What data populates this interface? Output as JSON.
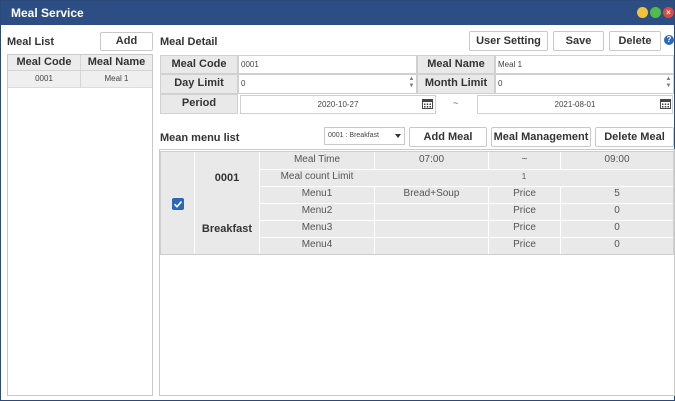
{
  "window": {
    "title": "Meal Service"
  },
  "left": {
    "title": "Meal List",
    "add_label": "Add",
    "columns": [
      "Meal Code",
      "Meal Name"
    ],
    "rows": [
      {
        "code": "0001",
        "name": "Meal 1"
      }
    ]
  },
  "detail": {
    "title": "Meal Detail",
    "user_setting_label": "User Setting",
    "save_label": "Save",
    "delete_label": "Delete",
    "meal_code_label": "Meal Code",
    "meal_code_value": "0001",
    "meal_name_label": "Meal Name",
    "meal_name_value": "Meal 1",
    "day_limit_label": "Day Limit",
    "day_limit_value": "0",
    "month_limit_label": "Month Limit",
    "month_limit_value": "0",
    "period_label": "Period",
    "period_start": "2020-10-27",
    "period_sep": "~",
    "period_end": "2021-08-01"
  },
  "menu": {
    "title": "Mean menu list",
    "select_value": "0001 : Breakfast",
    "add_meal_label": "Add Meal",
    "meal_management_label": "Meal Management",
    "delete_meal_label": "Delete Meal",
    "code": "0001",
    "name": "Breakfast",
    "checked": true,
    "meal_time_label": "Meal Time",
    "meal_time_start": "07:00",
    "meal_time_sep": "~",
    "meal_time_end": "09:00",
    "count_limit_label": "Meal count Limit",
    "count_limit_value": "1",
    "items": [
      {
        "label": "Menu1",
        "value": "Bread+Soup",
        "price_label": "Price",
        "price": "5"
      },
      {
        "label": "Menu2",
        "value": "",
        "price_label": "Price",
        "price": "0"
      },
      {
        "label": "Menu3",
        "value": "",
        "price_label": "Price",
        "price": "0"
      },
      {
        "label": "Menu4",
        "value": "",
        "price_label": "Price",
        "price": "0"
      }
    ]
  },
  "colors": {
    "titlebar": "#2d4e85",
    "accent": "#2d67b8",
    "header_bg": "#e9e9e9"
  },
  "icons": [
    "calendar-icon",
    "help-icon",
    "minimize-icon",
    "maximize-icon",
    "close-icon",
    "checkbox-icon",
    "chevron-down-icon"
  ]
}
